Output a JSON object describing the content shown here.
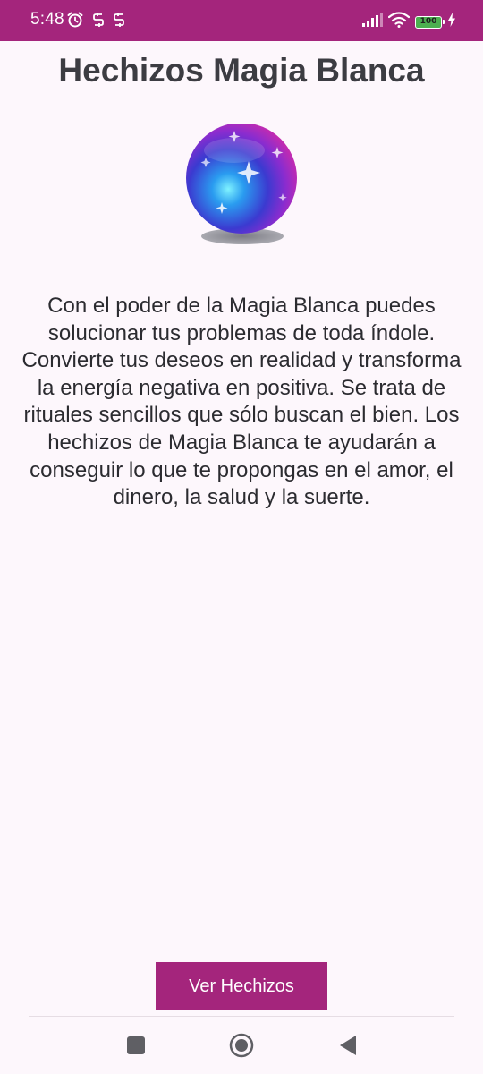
{
  "status_bar": {
    "time": "5:48",
    "battery_level": "100",
    "icons": [
      "alarm-icon",
      "sync-icon",
      "sync-icon",
      "signal-icon",
      "wifi-icon",
      "battery-icon",
      "charging-icon"
    ]
  },
  "main": {
    "title": "Hechizos Magia Blanca",
    "description": "Con el poder de la Magia Blanca puedes solucionar tus problemas de toda índole. Convierte tus deseos en realidad y transforma la energía negativa en positiva. Se trata de rituales sencillos que sólo buscan el bien. Los hechizos de Magia Blanca te ayudarán a conseguir lo que te propongas en el amor, el dinero, la salud y la suerte.",
    "image": "crystal-ball-icon",
    "button_label": "Ver Hechizos"
  },
  "nav_bar": {
    "buttons": [
      "recents-icon",
      "home-icon",
      "back-icon"
    ]
  },
  "colors": {
    "accent": "#a4257c",
    "background": "#fdf7fc",
    "text": "#2b2b30"
  }
}
